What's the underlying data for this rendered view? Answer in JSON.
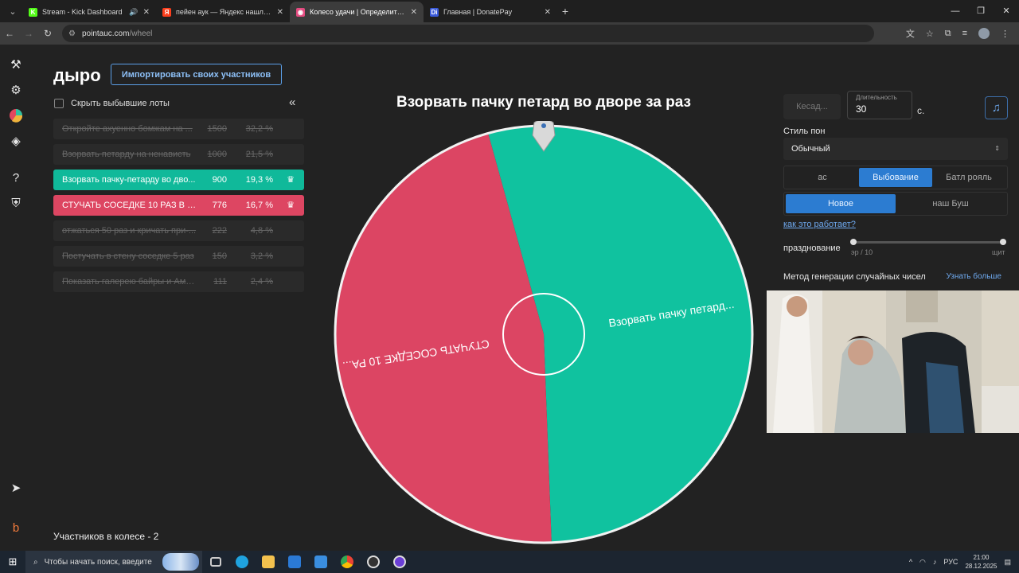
{
  "browser": {
    "tabs": [
      {
        "title": "Stream - Kick Dashboard",
        "fav": "K",
        "fav_color": "#53fc18",
        "sound": true
      },
      {
        "title": "пейен аук — Яндекс нашлось",
        "fav": "Я",
        "fav_color": "#fc3f1d"
      },
      {
        "title": "Колесо удачи | Определите по",
        "fav": "◉",
        "fav_color": "#e34b80",
        "active": true
      },
      {
        "title": "Главная | DonatePay",
        "fav": "Di",
        "fav_color": "#3b5bdb"
      }
    ],
    "new_tab": "+",
    "url_host": "pointauc.com",
    "url_path": "/wheel"
  },
  "app": {
    "brand": "дыро",
    "import_button": "Импортировать своих участников",
    "hide_dropped": "Скрыть выбывшие лоты",
    "collapse": "«",
    "lots": [
      {
        "name": "Откройте ахуенно бомжам на ...",
        "amount": "1500",
        "percent": "32,2 %",
        "state": "dropped"
      },
      {
        "name": "Взорвать петарду на ненависть",
        "amount": "1000",
        "percent": "21,5 %",
        "state": "dropped"
      },
      {
        "name": "Взорвать пачку-петарду во дво...",
        "amount": "900",
        "percent": "19,3 %",
        "state": "active",
        "color": "#10b99a"
      },
      {
        "name": "СТУЧАТЬ СОСЕДКЕ 10 РАЗ В СТ...",
        "amount": "776",
        "percent": "16,7 %",
        "state": "active",
        "color": "#dd4662"
      },
      {
        "name": "отжаться 50 раз и кричать при-...",
        "amount": "222",
        "percent": "4,8 %",
        "state": "dropped"
      },
      {
        "name": "Постучать в стену соседке 5 раз",
        "amount": "150",
        "percent": "3,2 %",
        "state": "dropped"
      },
      {
        "name": "Показать галерею байры и Амы-...",
        "amount": "111",
        "percent": "2,4 %",
        "state": "dropped"
      }
    ],
    "participants_count": "Участников в колесе - 2",
    "wheel": {
      "title": "Взорвать пачку петард во дворе за раз",
      "segments": [
        {
          "label": "Взорвать пачку петард...",
          "share": 0.537,
          "color": "#10c29f"
        },
        {
          "label": "СТУЧАТЬ СОСЕДКЕ 10 РА...",
          "share": 0.463,
          "color": "#dc4563"
        }
      ]
    },
    "settings": {
      "preset_placeholder": "Кесад...",
      "duration_label": "Длительность",
      "duration_value": "30",
      "duration_unit": "с.",
      "style_label": "Стиль пон",
      "style_value": "Обычный",
      "modes": [
        "ас",
        "Выбование",
        "Батл рояль"
      ],
      "mode_selected": "Выбование",
      "order": [
        "Новое",
        "наш Буш"
      ],
      "order_selected": "Новое",
      "how_it_works": "как это работает?",
      "celebration_label": "празднование",
      "celebration_left": "эр / 10",
      "celebration_right": "щит",
      "rng_label": "Метод генерации случайных чисел",
      "learn_more": "Узнать больше"
    }
  },
  "taskbar": {
    "search_placeholder": "Чтобы начать поиск, введите",
    "lang": "РУС",
    "time": "21:00",
    "date": "28.12.2025"
  }
}
